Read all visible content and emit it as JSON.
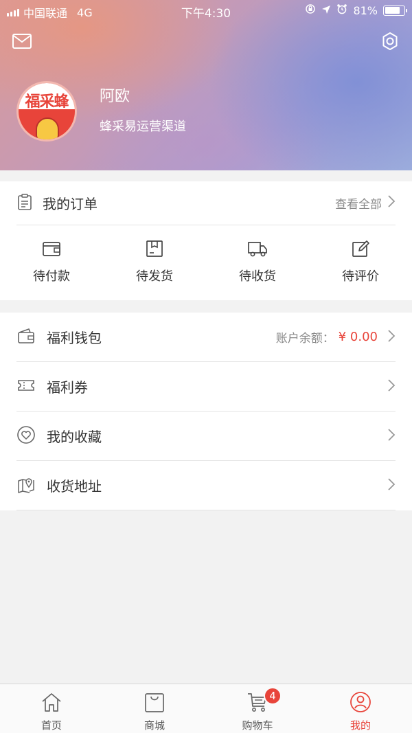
{
  "status_bar": {
    "carrier": "中国联通",
    "network": "4G",
    "time": "下午4:30",
    "battery": "81%",
    "battery_level": 0.81
  },
  "profile": {
    "avatar_text": "福采蜂",
    "name": "阿欧",
    "subtitle": "蜂采易运营渠道"
  },
  "orders": {
    "title": "我的订单",
    "view_all": "查看全部",
    "statuses": [
      {
        "label": "待付款",
        "icon": "wallet-icon"
      },
      {
        "label": "待发货",
        "icon": "package-icon"
      },
      {
        "label": "待收货",
        "icon": "truck-icon"
      },
      {
        "label": "待评价",
        "icon": "edit-icon"
      }
    ]
  },
  "menu": {
    "wallet": {
      "label": "福利钱包",
      "balance_label": "账户余额：",
      "balance_value": "¥ 0.00"
    },
    "coupon": {
      "label": "福利券"
    },
    "favorites": {
      "label": "我的收藏"
    },
    "address": {
      "label": "收货地址"
    }
  },
  "tabs": [
    {
      "label": "首页",
      "icon": "home-icon"
    },
    {
      "label": "商城",
      "icon": "shopping-bag-icon"
    },
    {
      "label": "购物车",
      "icon": "cart-icon",
      "badge": "4"
    },
    {
      "label": "我的",
      "icon": "user-icon",
      "active": true
    }
  ],
  "colors": {
    "accent": "#e8443a",
    "text": "#333333",
    "muted": "#888888"
  }
}
